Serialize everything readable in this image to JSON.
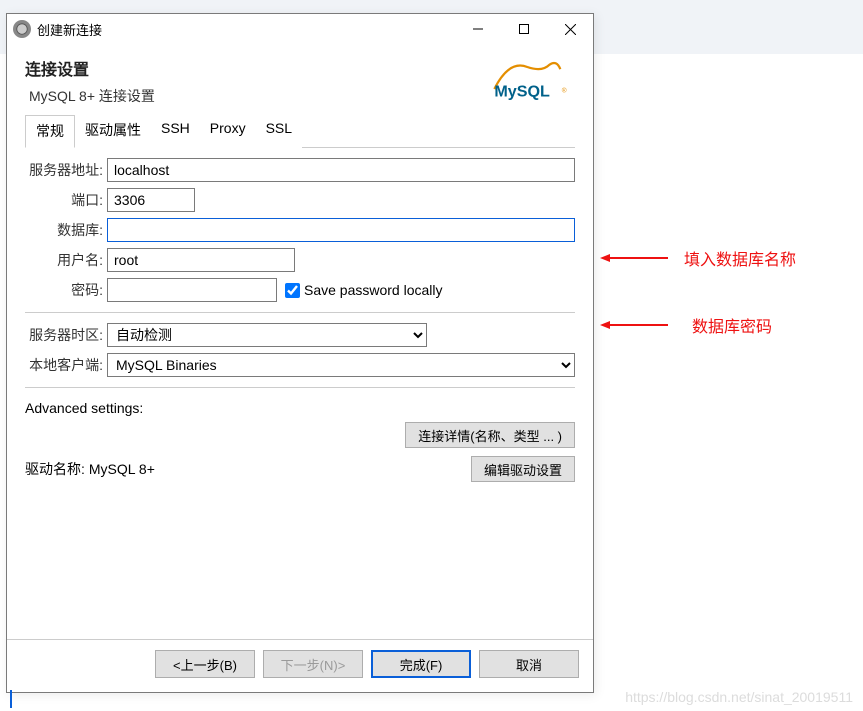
{
  "window": {
    "title": "创建新连接"
  },
  "header": {
    "title": "连接设置",
    "subtitle": "MySQL 8+ 连接设置"
  },
  "tabs": [
    "常规",
    "驱动属性",
    "SSH",
    "Proxy",
    "SSL"
  ],
  "active_tab": 0,
  "form": {
    "host_label": "服务器地址:",
    "host_value": "localhost",
    "port_label": "端口:",
    "port_value": "3306",
    "db_label": "数据库:",
    "db_value": "",
    "user_label": "用户名:",
    "user_value": "root",
    "pwd_label": "密码:",
    "pwd_value": "",
    "save_pwd_label": "Save password locally",
    "save_pwd_checked": true,
    "tz_label": "服务器时区:",
    "tz_value": "自动检测",
    "client_label": "本地客户端:",
    "client_value": "MySQL Binaries"
  },
  "advanced": {
    "heading": "Advanced settings:",
    "details_btn": "连接详情(名称、类型 ... )"
  },
  "driver": {
    "label": "驱动名称:",
    "value": "MySQL 8+",
    "edit_btn": "编辑驱动设置"
  },
  "footer": {
    "back": "<上一步(B)",
    "next": "下一步(N)>",
    "finish": "完成(F)",
    "cancel": "取消"
  },
  "annotations": {
    "db_hint": "填入数据库名称",
    "pwd_hint": "数据库密码"
  },
  "watermark": "https://blog.csdn.net/sinat_20019511"
}
